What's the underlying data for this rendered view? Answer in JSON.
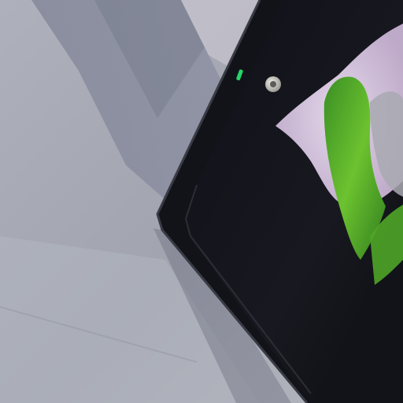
{
  "scene": {
    "subject": "tablet-on-surface",
    "colors": {
      "surface_light": "#b6b8c2",
      "surface_mid": "#9fa2ad",
      "surface_shadow": "#6f7282",
      "bezel": "#111216",
      "bezel_edge": "#2a2c33",
      "screen_dark": "#15161c",
      "screen_purple": "#cfc0d8",
      "screen_green": "#63b82c",
      "screen_green_dark": "#2e7a1c",
      "camera": "#d7d6cf",
      "led": "#27d36a"
    }
  }
}
